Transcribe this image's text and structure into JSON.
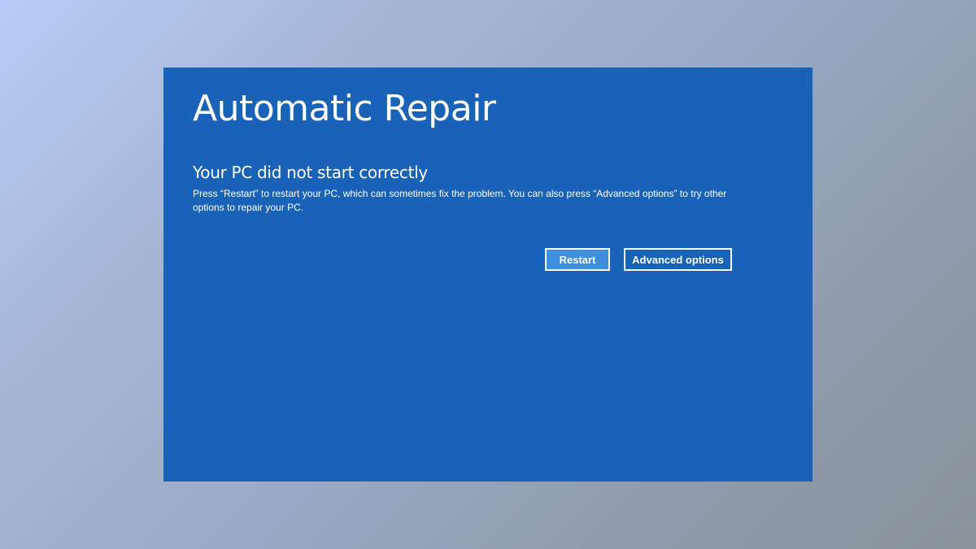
{
  "screen": {
    "title": "Automatic Repair",
    "subtitle": "Your PC did not start correctly",
    "description": "Press “Restart” to restart your PC, which can sometimes fix the problem. You can also press “Advanced options” to try other options to repair your PC.",
    "background_color": "#1862b8"
  },
  "buttons": {
    "restart_label": "Restart",
    "advanced_label": "Advanced options",
    "primary_color": "#3e8fdb"
  }
}
